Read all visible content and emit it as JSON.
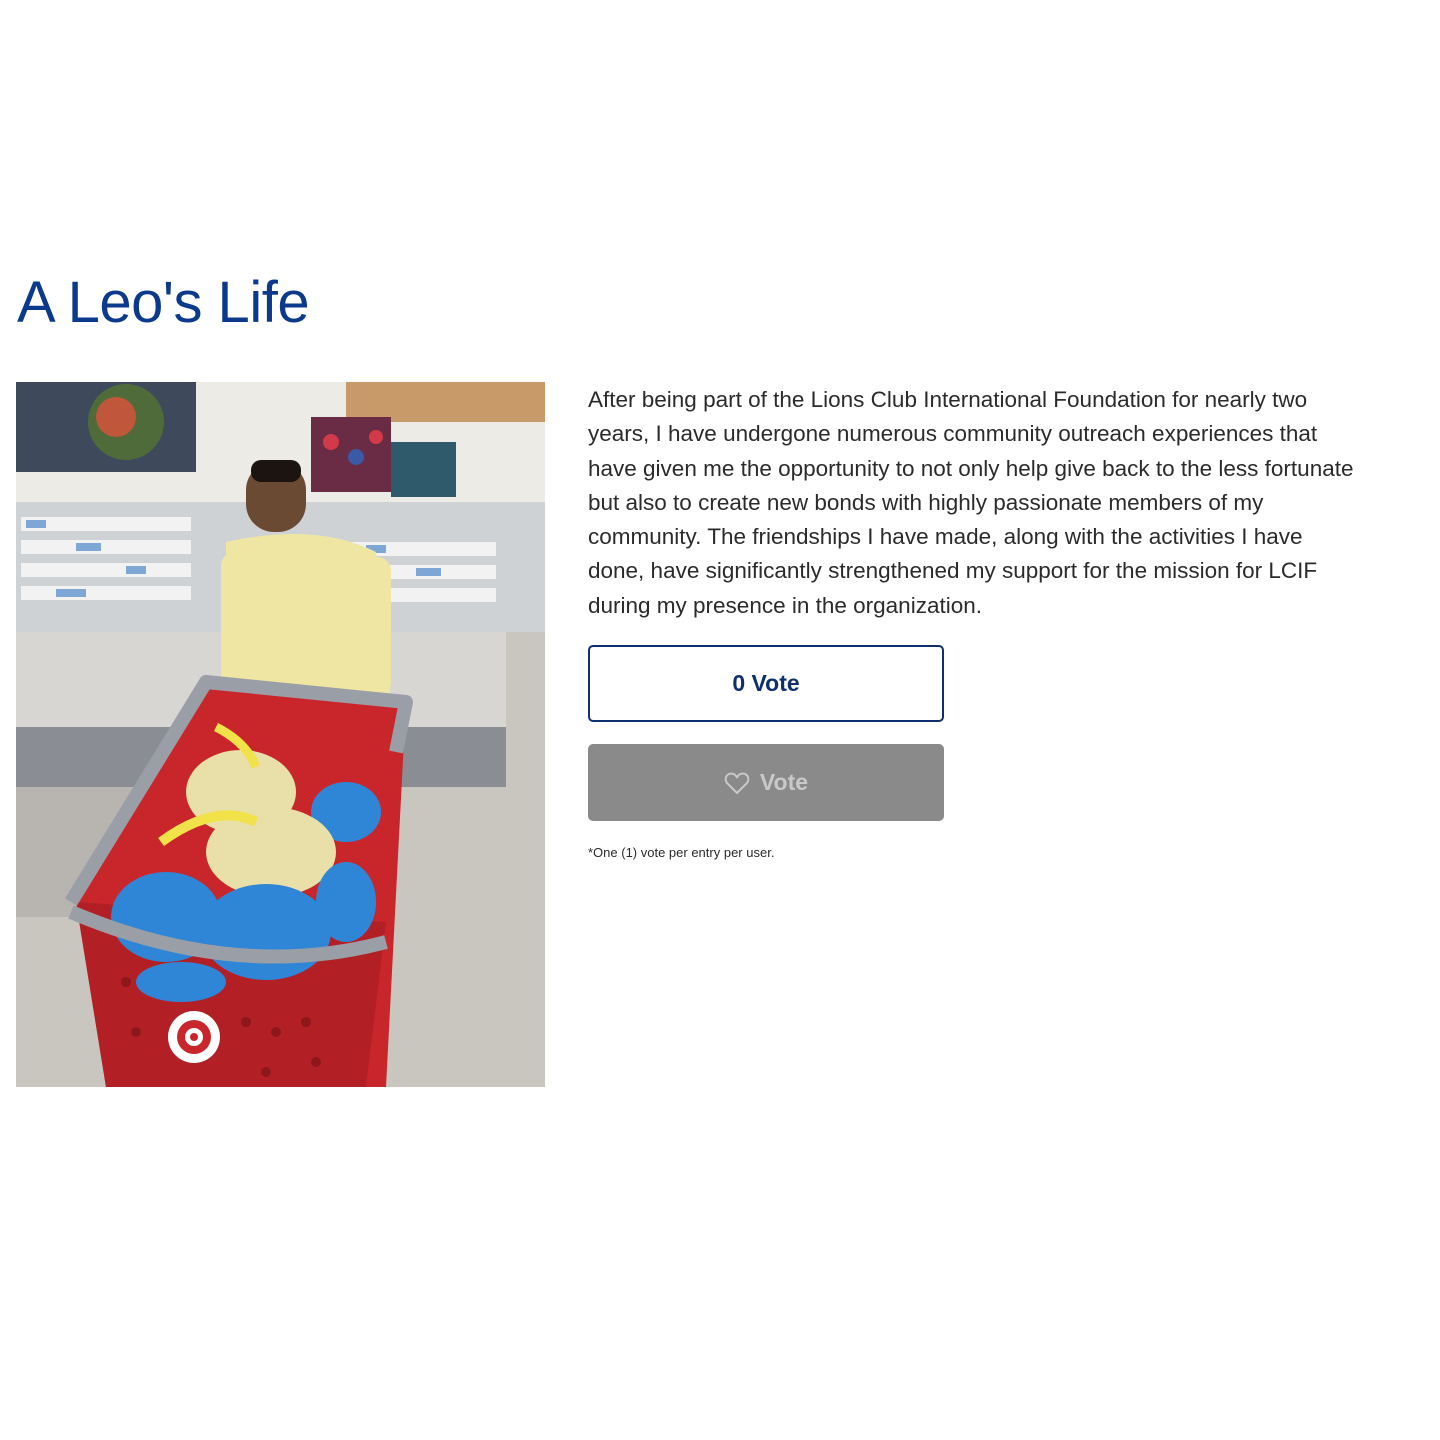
{
  "entry": {
    "title": "A Leo's Life",
    "photo_alt": "Leo member with a shopping cart full of turkeys in a grocery store",
    "description": "After being part of the Lions Club International Foundation for nearly two years, I have undergone numerous community outreach experiences that have given me the opportunity to not only help give back to the less fortunate but also to create new bonds with highly passionate members of my community. The friendships I have made, along with the activities I have done, have significantly strengthened my support for the mission for LCIF during my presence in the organization."
  },
  "votes": {
    "count_label": "0 Vote",
    "button_label": "Vote",
    "button_icon": "heart-outline-icon",
    "disclaimer": "*One (1) vote per entry per user."
  },
  "colors": {
    "title": "#0b3a8c",
    "vote_count_border": "#0f2f6e",
    "vote_button_bg": "#8a8a8a",
    "vote_button_text": "#c9c9c9"
  }
}
